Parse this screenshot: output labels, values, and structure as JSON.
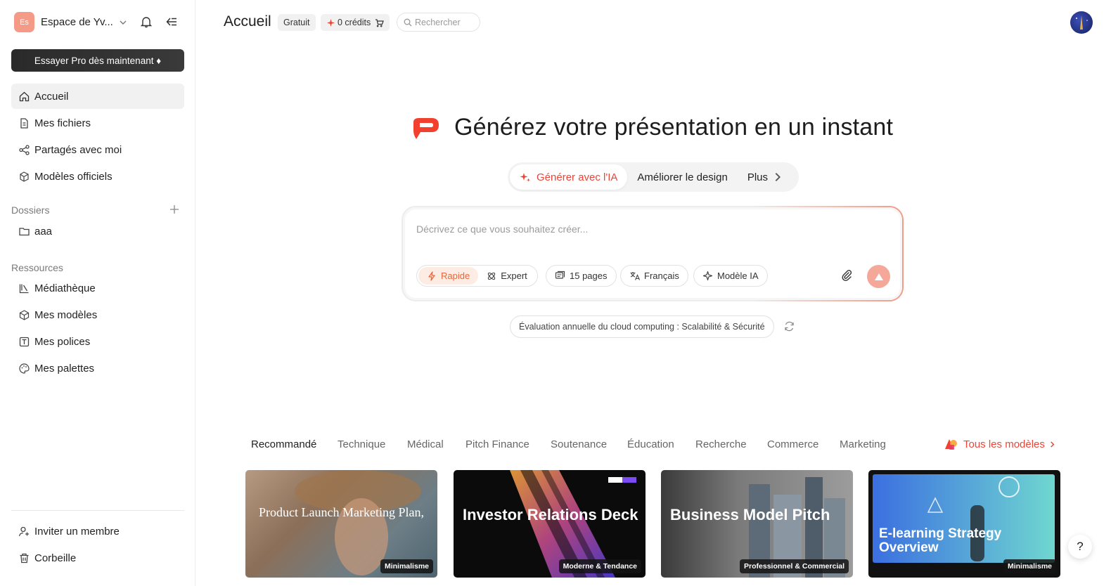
{
  "sidebar": {
    "workspace_initials": "Es",
    "workspace_name": "Espace de Yv...",
    "pro_button": "Essayer Pro dès maintenant ♦",
    "nav": [
      {
        "label": "Accueil",
        "icon": "home-icon"
      },
      {
        "label": "Mes fichiers",
        "icon": "file-icon"
      },
      {
        "label": "Partagés avec moi",
        "icon": "share-icon"
      },
      {
        "label": "Modèles officiels",
        "icon": "templates-icon"
      }
    ],
    "folders_label": "Dossiers",
    "folders": [
      {
        "label": "aaa",
        "icon": "folder-icon"
      }
    ],
    "resources_label": "Ressources",
    "resources": [
      {
        "label": "Médiathèque",
        "icon": "media-library-icon"
      },
      {
        "label": "Mes modèles",
        "icon": "cube-icon"
      },
      {
        "label": "Mes polices",
        "icon": "font-icon"
      },
      {
        "label": "Mes palettes",
        "icon": "palette-icon"
      }
    ],
    "bottom": [
      {
        "label": "Inviter un membre",
        "icon": "invite-user-icon"
      },
      {
        "label": "Corbeille",
        "icon": "trash-icon"
      }
    ]
  },
  "header": {
    "title": "Accueil",
    "plan_badge": "Gratuit",
    "credits": "0 crédits",
    "search_placeholder": "Rechercher"
  },
  "hero": {
    "title": "Générez votre présentation en un instant",
    "tabs": [
      {
        "label": "Générer avec l'IA",
        "active": true
      },
      {
        "label": "Améliorer le design",
        "active": false
      },
      {
        "label": "Plus",
        "active": false
      }
    ],
    "prompt_placeholder": "Décrivez ce que vous souhaitez créer...",
    "speed_options": [
      "Rapide",
      "Expert"
    ],
    "options": {
      "pages": "15 pages",
      "language": "Français",
      "model": "Modèle IA"
    },
    "suggestion": "Évaluation annuelle du cloud computing : Scalabilité & Sécurité"
  },
  "categories": [
    "Recommandé",
    "Technique",
    "Médical",
    "Pitch Finance",
    "Soutenance",
    "Éducation",
    "Recherche",
    "Commerce",
    "Marketing"
  ],
  "all_models": "Tous les modèles",
  "templates": [
    {
      "title": "Product Launch Marketing Plan,",
      "badge": "Minimalisme"
    },
    {
      "title": "Investor Relations Deck",
      "badge": "Moderne & Tendance"
    },
    {
      "title": "Business Model Pitch",
      "badge": "Professionnel & Commercial"
    },
    {
      "title": "E-learning Strategy Overview",
      "badge": "Minimalisme"
    }
  ],
  "help": "?",
  "colors": {
    "accent": "#e8463a",
    "pro_button_bg": "#2a2a2a",
    "active_nav_bg": "#f1f1f1"
  }
}
